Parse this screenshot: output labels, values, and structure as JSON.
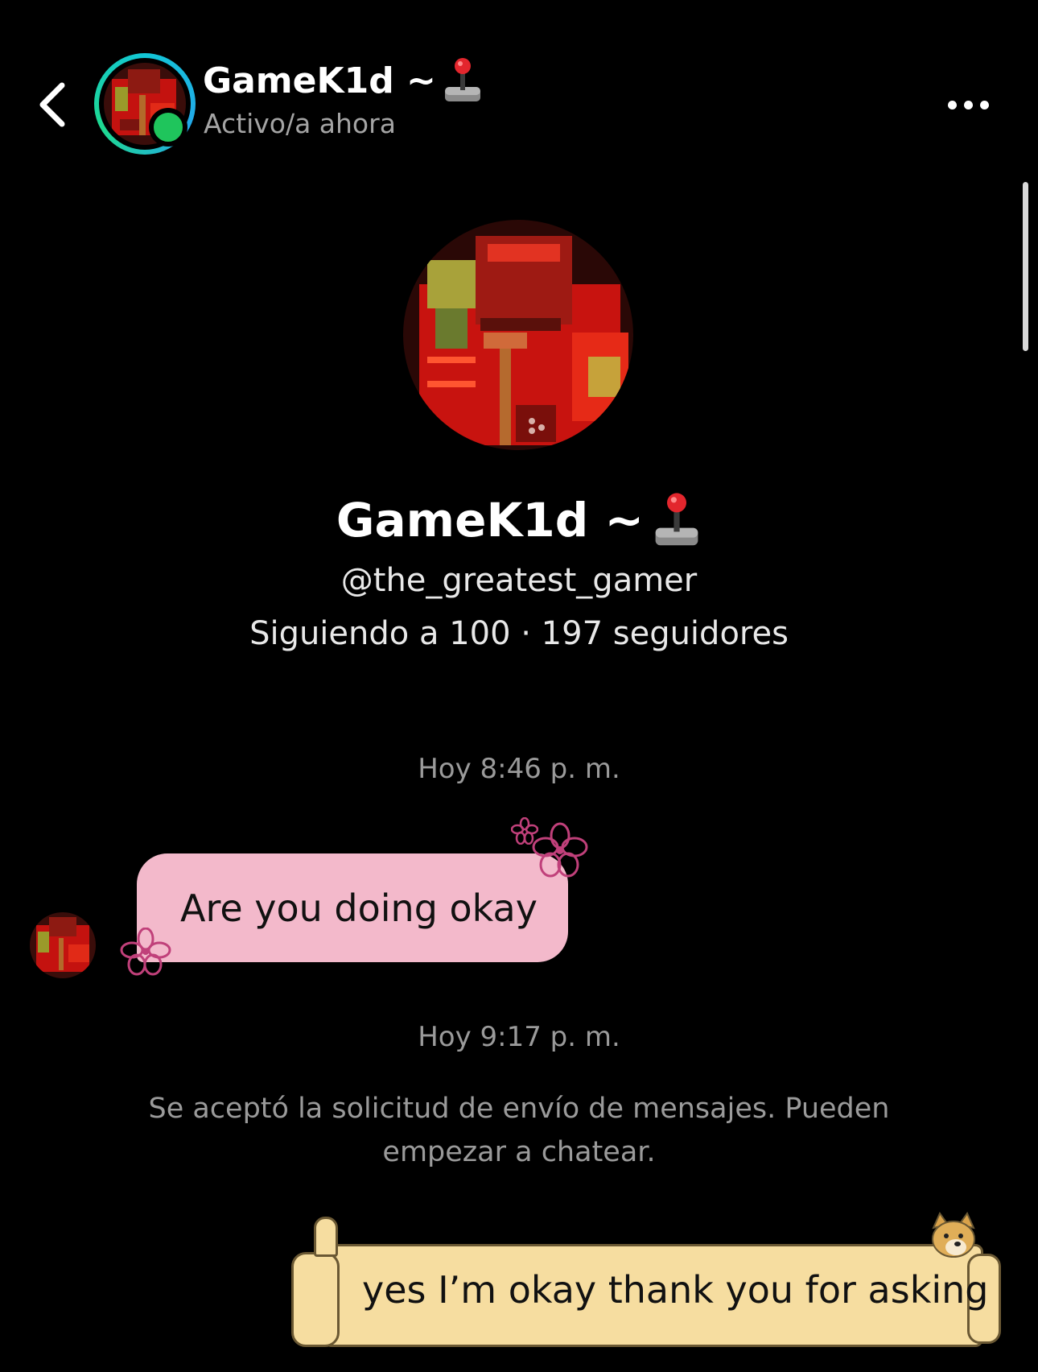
{
  "header": {
    "contact_name": "GameK1d ~",
    "name_emoji": "joystick-icon",
    "status": "Activo/a ahora"
  },
  "profile": {
    "display_name": "GameK1d ~",
    "handle": "@the_greatest_gamer",
    "stats": "Siguiendo a 100 · 197 seguidores"
  },
  "chat": {
    "timestamps": [
      "Hoy 8:46 p. m.",
      "Hoy 9:17 p. m."
    ],
    "incoming_message": "Are you doing okay",
    "system_note": "Se aceptó la solicitud de envío de mensajes. Pueden empezar a chatear.",
    "outgoing_message": "yes I’m okay thank you for asking"
  },
  "colors": {
    "background": "#000000",
    "incoming_bubble": "#f3b9cb",
    "outgoing_bubble": "#f6dda0",
    "online": "#1fc55c",
    "muted_text": "#9a9a9a"
  }
}
